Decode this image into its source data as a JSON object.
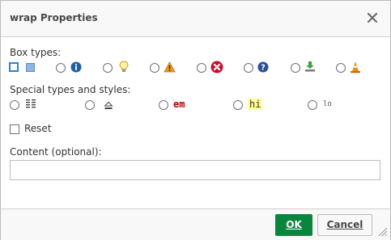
{
  "dialog": {
    "title": "wrap Properties",
    "close_icon": "close-icon"
  },
  "box_types": {
    "label": "Box types:",
    "options": [
      {
        "icon": "plain-box-icon",
        "selected": true
      },
      {
        "icon": "info-icon",
        "selected": false
      },
      {
        "icon": "lightbulb-icon",
        "selected": false
      },
      {
        "icon": "warning-icon",
        "selected": false
      },
      {
        "icon": "error-icon",
        "selected": false
      },
      {
        "icon": "help-icon",
        "selected": false
      },
      {
        "icon": "download-icon",
        "selected": false
      },
      {
        "icon": "todo-cone-icon",
        "selected": false
      }
    ]
  },
  "special_types": {
    "label": "Special types and styles:",
    "options": [
      {
        "icon": "columns-icon"
      },
      {
        "icon": "clear-float-icon"
      },
      {
        "icon": "em-style-icon",
        "text": "em"
      },
      {
        "icon": "highlight-icon",
        "text": "hi"
      },
      {
        "icon": "lo-style-icon",
        "text": "lo"
      }
    ]
  },
  "reset": {
    "label": "Reset",
    "checked": false
  },
  "content": {
    "label": "Content (optional):",
    "value": ""
  },
  "buttons": {
    "ok": "OK",
    "cancel": "Cancel"
  },
  "colors": {
    "ok_button": "#09863e",
    "title_bar": "#f8f8f8",
    "selected_outline": "#2b83d9"
  }
}
